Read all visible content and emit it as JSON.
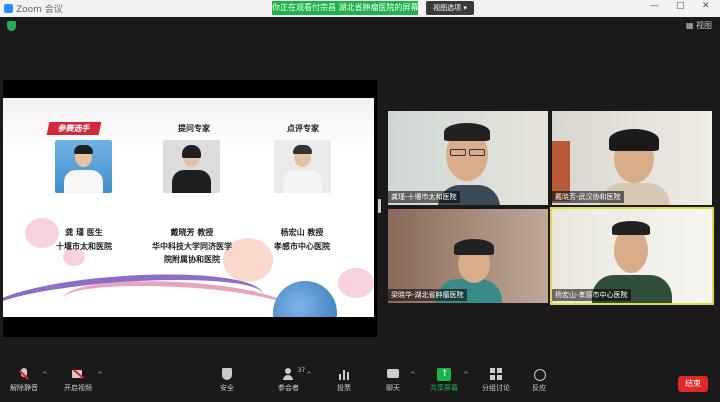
{
  "window": {
    "app_title": "Zoom 会议",
    "share_banner": "你正在观看付宗昌 湖北省肿瘤医院的屏幕",
    "view_options": "视图选项 ▾",
    "controls": {
      "minimize": "—",
      "maximize": "□",
      "close": "✕"
    }
  },
  "top": {
    "view_label": "视图"
  },
  "slide": {
    "sections": {
      "contestant": "参赛选手",
      "questioner": "提问专家",
      "reviewer": "点评专家"
    },
    "people": [
      {
        "name": "龚 瑾  医生",
        "org": [
          "十堰市太和医院"
        ]
      },
      {
        "name": "戴晓芳  教授",
        "org": [
          "华中科技大学同济医学",
          "院附属协和医院"
        ]
      },
      {
        "name": "杨宏山  教授",
        "org": [
          "孝感市中心医院"
        ]
      }
    ]
  },
  "videos": [
    {
      "label": "龚瑾-十堰市太和医院"
    },
    {
      "label": "戴晓芳-武汉协和医院"
    },
    {
      "label": "梁晓华-湖北省肿瘤医院"
    },
    {
      "label": "杨宏山-孝感市中心医院"
    }
  ],
  "toolbar": {
    "mute": "解除静音",
    "video": "开启视频",
    "security": "安全",
    "participants": "参会者",
    "participants_count": "37",
    "polls": "投票",
    "chat": "聊天",
    "share": "共享屏幕",
    "breakout": "分组讨论",
    "reactions": "反应",
    "end": "结束"
  },
  "colors": {
    "accent_green": "#1bb34a",
    "end_red": "#e02828",
    "active_speaker": "#e3d84a",
    "section_red": "#d6283a"
  }
}
